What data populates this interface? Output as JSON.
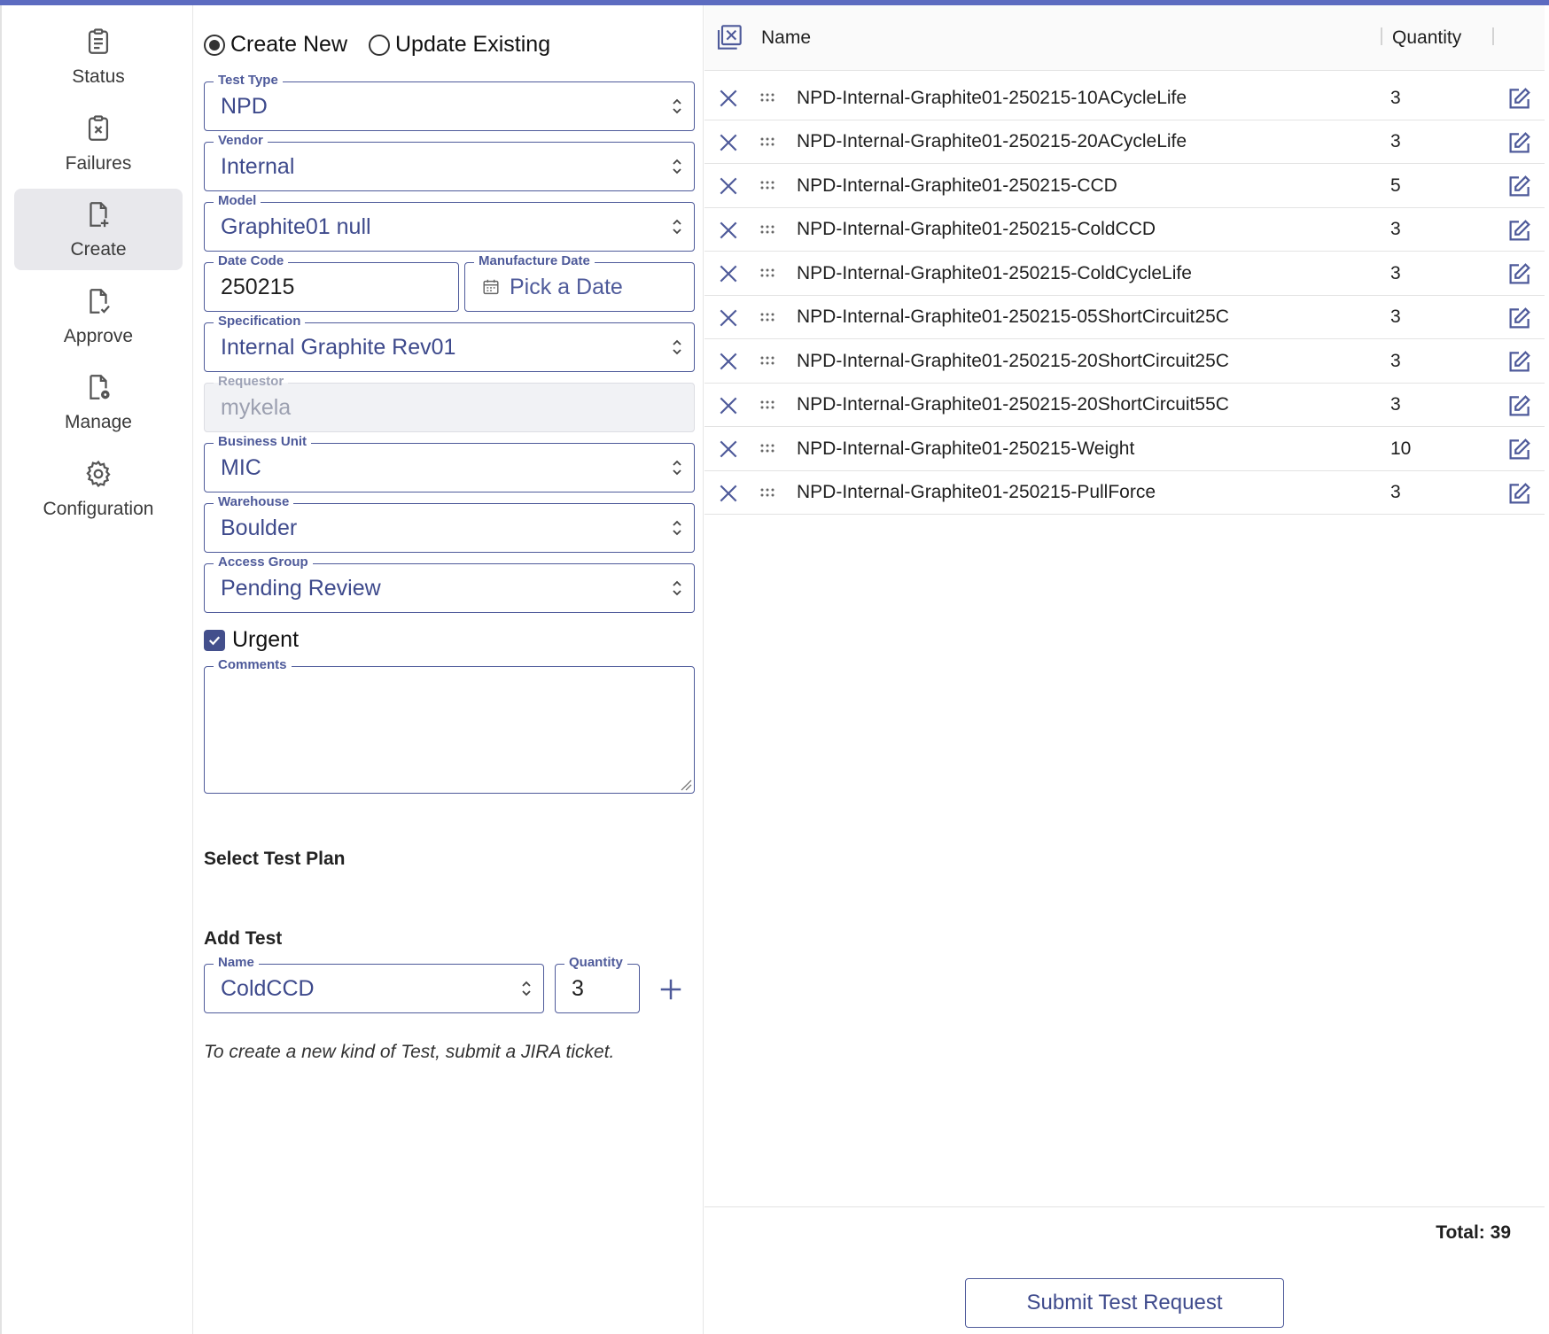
{
  "sidebar": {
    "items": [
      {
        "label": "Status",
        "icon": "clipboard-icon",
        "active": false
      },
      {
        "label": "Failures",
        "icon": "clipboard-x-icon",
        "active": false
      },
      {
        "label": "Create",
        "icon": "file-plus-icon",
        "active": true
      },
      {
        "label": "Approve",
        "icon": "file-check-icon",
        "active": false
      },
      {
        "label": "Manage",
        "icon": "file-gear-icon",
        "active": false
      },
      {
        "label": "Configuration",
        "icon": "gear-icon",
        "active": false
      }
    ]
  },
  "form": {
    "mode": {
      "create_label": "Create New",
      "update_label": "Update Existing",
      "selected": "create"
    },
    "test_type": {
      "label": "Test Type",
      "value": "NPD"
    },
    "vendor": {
      "label": "Vendor",
      "value": "Internal"
    },
    "model": {
      "label": "Model",
      "value": "Graphite01 null"
    },
    "date_code": {
      "label": "Date Code",
      "value": "250215"
    },
    "manufacture_date": {
      "label": "Manufacture Date",
      "placeholder": "Pick a Date"
    },
    "specification": {
      "label": "Specification",
      "value": "Internal Graphite Rev01"
    },
    "requestor": {
      "label": "Requestor",
      "value": "mykela"
    },
    "business_unit": {
      "label": "Business Unit",
      "value": "MIC"
    },
    "warehouse": {
      "label": "Warehouse",
      "value": "Boulder"
    },
    "access_group": {
      "label": "Access Group",
      "value": "Pending Review"
    },
    "urgent": {
      "label": "Urgent",
      "checked": true
    },
    "comments": {
      "label": "Comments",
      "value": ""
    },
    "select_test_plan_label": "Select Test Plan",
    "add_test": {
      "title": "Add Test",
      "name_label": "Name",
      "name_value": "ColdCCD",
      "quantity_label": "Quantity",
      "quantity_value": "3",
      "hint": "To create a new kind of Test, submit a JIRA ticket."
    }
  },
  "table": {
    "columns": {
      "name": "Name",
      "quantity": "Quantity"
    },
    "rows": [
      {
        "name": "NPD-Internal-Graphite01-250215-10ACycleLife",
        "quantity": "3"
      },
      {
        "name": "NPD-Internal-Graphite01-250215-20ACycleLife",
        "quantity": "3"
      },
      {
        "name": "NPD-Internal-Graphite01-250215-CCD",
        "quantity": "5"
      },
      {
        "name": "NPD-Internal-Graphite01-250215-ColdCCD",
        "quantity": "3"
      },
      {
        "name": "NPD-Internal-Graphite01-250215-ColdCycleLife",
        "quantity": "3"
      },
      {
        "name": "NPD-Internal-Graphite01-250215-05ShortCircuit25C",
        "quantity": "3"
      },
      {
        "name": "NPD-Internal-Graphite01-250215-20ShortCircuit25C",
        "quantity": "3"
      },
      {
        "name": "NPD-Internal-Graphite01-250215-20ShortCircuit55C",
        "quantity": "3"
      },
      {
        "name": "NPD-Internal-Graphite01-250215-Weight",
        "quantity": "10"
      },
      {
        "name": "NPD-Internal-Graphite01-250215-PullForce",
        "quantity": "3"
      }
    ],
    "total_label": "Total: 39",
    "submit_label": "Submit Test Request"
  },
  "colors": {
    "accent": "#4e5a9a",
    "accent_text": "#3e4a8c",
    "topbar": "#5c6bc0",
    "active_nav": "#e8e8ec"
  }
}
